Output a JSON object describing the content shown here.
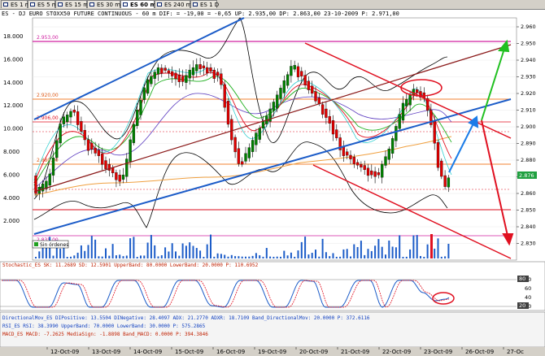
{
  "tabs": [
    {
      "label": "ES 1 m",
      "active": false
    },
    {
      "label": "ES 5 m",
      "active": false
    },
    {
      "label": "ES 15 m",
      "active": false
    },
    {
      "label": "ES 30 m",
      "active": false
    },
    {
      "label": "ES 60 m",
      "active": true
    },
    {
      "label": "ES 240 m",
      "active": false
    },
    {
      "label": "ES 1 D",
      "active": false
    }
  ],
  "header": {
    "main_info": "ES - DJ EURO STOXX50 FUTURE CONTINUOUS - 60 m DIF: = -19,00 = -0,65 UP: 2.935,00 DP: 2.863,00 23-10-2009 P: 2.971,00"
  },
  "panels": {
    "stoch_info": "Stochastic_ES SK: 11.2689 SD: 12.5901 UpperBand: 80.0000 LowerBand: 20.0000 P: 110.6952",
    "dmi_info": "DirectionalMov_ES DIPositive: 13.5504 DINegative: 28.4097 ADX: 21.2770 ADXR: 18.7109 Band_DirectionalMov: 20.0000 P: 372.6116",
    "rsi_info": "RSI_ES RSI: 38.3990 UpperBand: 70.0000 LowerBand: 30.0000 P: 575.2865",
    "macd_info": "MACD_ES MACD: -7.2625 MediaSign: -1.8898 Band_MACD: 0.0000 P: 394.3846"
  },
  "levels": {
    "l2953": "2.953,00",
    "l2920": "2.920,00",
    "l2906": "2.906,00",
    "l2880": "2.880,00",
    "l2835": "2.835,00"
  },
  "badges": {
    "ordenes": "Sin órdenes",
    "price_tag": "2.876",
    "oscillator_tag": "80",
    "low_tag": "20"
  },
  "axes": {
    "left_ticks": [
      "18.000",
      "16.000",
      "14.000",
      "12.000",
      "10.000",
      "8.000",
      "6.000",
      "4.000",
      "2.000"
    ],
    "right_ticks": [
      "2.960",
      "2.950",
      "2.940",
      "2.930",
      "2.920",
      "2.910",
      "2.900",
      "2.890",
      "2.880",
      "2.870",
      "2.860",
      "2.850",
      "2.840",
      "2.830"
    ],
    "dates": [
      "12-Oct-09",
      "13-Oct-09",
      "14-Oct-09",
      "15-Oct-09",
      "16-Oct-09",
      "19-Oct-09",
      "20-Oct-09",
      "21-Oct-09",
      "22-Oct-09",
      "23-Oct-09",
      "26-Oct-09",
      "27-Oc"
    ],
    "lower_ticks": [
      "80",
      "60",
      "40",
      "20"
    ]
  },
  "colors": {
    "bull": "#008000",
    "bear": "#e00000",
    "blue": "#1c5cc8",
    "red": "#e01020",
    "maroon": "#8b1a1a",
    "green": "#20b020",
    "magenta": "#d020a0",
    "orange": "#f0a040"
  }
}
